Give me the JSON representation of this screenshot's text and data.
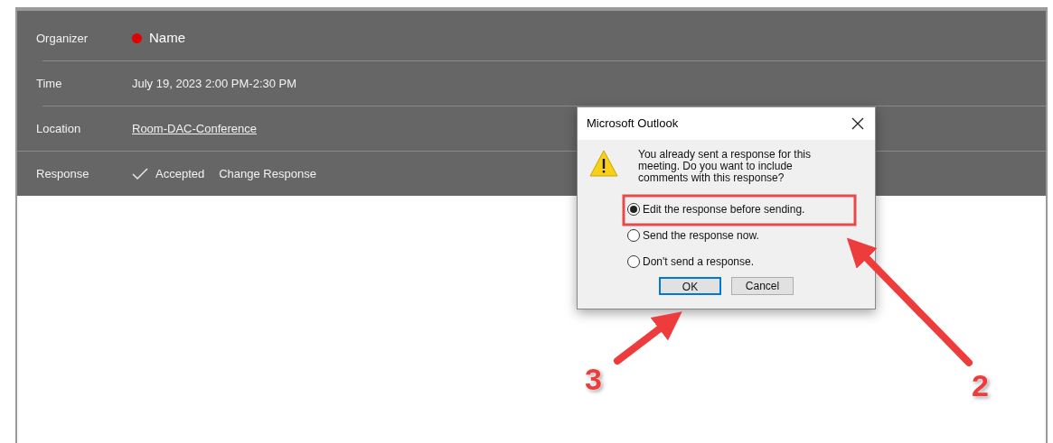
{
  "details": {
    "rows": [
      {
        "label": "Organizer",
        "kind": "person",
        "value": "Name"
      },
      {
        "label": "Time",
        "kind": "text",
        "value": "July 19, 2023 2:00 PM-2:30 PM"
      },
      {
        "label": "Location",
        "kind": "link",
        "value": "Room-DAC-Conference"
      },
      {
        "label": "Response",
        "kind": "response",
        "value": "Accepted",
        "action": "Change Response"
      }
    ]
  },
  "dialog": {
    "title": "Microsoft Outlook",
    "message": "You already sent a response for this meeting. Do you want to include comments with this response?",
    "options": [
      {
        "label": "Edit the response before sending.",
        "selected": true
      },
      {
        "label": "Send the response now.",
        "selected": false
      },
      {
        "label": "Don't send a response.",
        "selected": false
      }
    ],
    "buttons": [
      {
        "label": "OK",
        "default": true
      },
      {
        "label": "Cancel",
        "default": false
      }
    ]
  },
  "annotations": [
    {
      "label": "3"
    },
    {
      "label": "2"
    }
  ]
}
